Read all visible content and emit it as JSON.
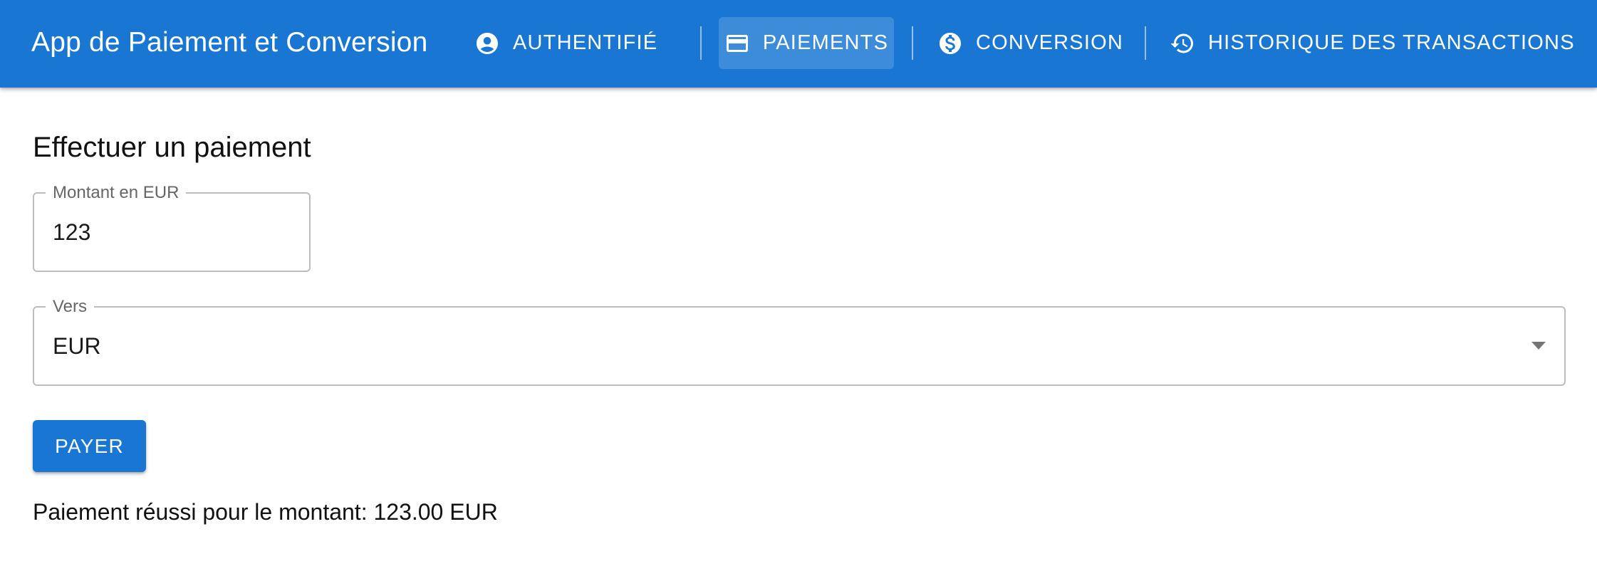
{
  "app": {
    "title": "App de Paiement et Conversion"
  },
  "nav": {
    "items": [
      {
        "label": "AUTHENTIFIÉ",
        "icon": "account-circle-icon",
        "active": false
      },
      {
        "label": "PAIEMENTS",
        "icon": "credit-card-icon",
        "active": true
      },
      {
        "label": "CONVERSION",
        "icon": "dollar-circle-icon",
        "active": false
      },
      {
        "label": "HISTORIQUE DES TRANSACTIONS",
        "icon": "history-icon",
        "active": false
      }
    ]
  },
  "payment": {
    "title": "Effectuer un paiement",
    "amount_label": "Montant en EUR",
    "amount_value": "123",
    "currency_label": "Vers",
    "currency_value": "EUR",
    "pay_button": "PAYER",
    "result_message": "Paiement réussi pour le montant: 123.00 EUR"
  },
  "colors": {
    "primary": "#1976d2",
    "active_tab_overlay": "rgba(255,255,255,0.16)",
    "field_border": "#bdbdbd",
    "label_gray": "#666666"
  }
}
